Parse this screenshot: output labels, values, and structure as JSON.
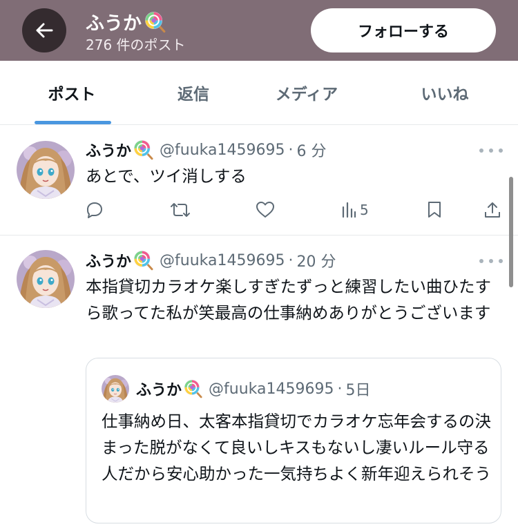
{
  "header": {
    "name": "ふうか",
    "post_count": "276 件のポスト",
    "follow_label": "フォローする",
    "back_icon": "arrow-left-icon",
    "colors": {
      "background": "#806d76",
      "back_button": "#342b2f"
    }
  },
  "tabs": [
    {
      "label": "ポスト",
      "active": true
    },
    {
      "label": "返信",
      "active": false
    },
    {
      "label": "メディア",
      "active": false
    },
    {
      "label": "いいね",
      "active": false
    }
  ],
  "accent_color": "#4a97e0",
  "posts": [
    {
      "name": "ふうか",
      "handle": "@fuuka1459695",
      "separator": "·",
      "time": "6 分",
      "text": "あとで、ツイ消しする",
      "actions": {
        "reply": "",
        "repost": "",
        "like": "",
        "views": "5",
        "bookmark": "",
        "share": ""
      }
    },
    {
      "name": "ふうか",
      "handle": "@fuuka1459695",
      "separator": "·",
      "time": "20 分",
      "text": "本指貸切カラオケ楽しすぎたずっと練習したい曲ひたすら歌ってた私が笑最高の仕事納めありがとうございます",
      "quote": {
        "name": "ふうか",
        "handle": "@fuuka1459695",
        "separator": "·",
        "time": "5日",
        "text": "仕事納め日、太客本指貸切でカラオケ忘年会するの決まった脱がなくて良いしキスもないし凄いルール守る人だから安心助かった一気持ちよく新年迎えられそう"
      }
    }
  ]
}
